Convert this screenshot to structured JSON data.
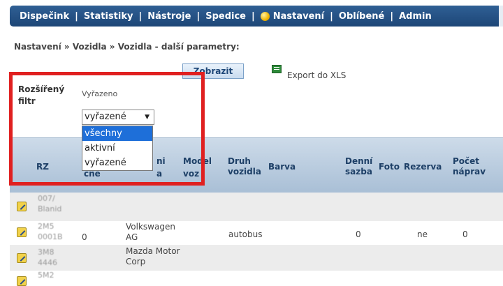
{
  "nav": {
    "items": [
      "Dispečink",
      "Statistiky",
      "Nástroje",
      "Spedice",
      "Nastavení",
      "Oblíbené",
      "Admin"
    ],
    "separator": "|"
  },
  "breadcrumb": "Nastavení » Vozidla » Vozidla - další parametry:",
  "toolbar": {
    "show_label": "Zobrazit",
    "export_label": "Export do XLS"
  },
  "filter": {
    "title": "Rozšířený filtr",
    "field_label": "Vyřazeno",
    "selected_value": "vyřazené",
    "options": [
      "všechny",
      "aktivní",
      "vyřazené"
    ],
    "highlighted_option": "všechny"
  },
  "table": {
    "headers": {
      "rz": "RZ",
      "vyrobce": "ni",
      "vyrobce_partial": "a",
      "model": "Model",
      "model_partial": "voz",
      "druh": "Druh vozidla",
      "barva": "Barva",
      "denni_sazba": "Denní sazba",
      "foto": "Foto",
      "rezerva": "Rezerva",
      "pocet_naprav": "Počet náprav",
      "stk_partial": "cne"
    },
    "rows": [
      {
        "rz": "007/",
        "rz2": "Blanid",
        "col2": "",
        "vyrobce": "",
        "druh": "",
        "sazba": "",
        "rezerva": "",
        "naprav": ""
      },
      {
        "rz": "2M5",
        "rz2": "0001B",
        "col2": "0",
        "vyrobce": "Volkswagen AG",
        "druh": "autobus",
        "sazba": "0",
        "rezerva": "ne",
        "naprav": "0"
      },
      {
        "rz": "3M8",
        "rz2": "4446",
        "col2": "",
        "vyrobce": "Mazda Motor Corp",
        "druh": "",
        "sazba": "",
        "rezerva": "",
        "naprav": ""
      },
      {
        "rz": "5M2",
        "rz2": "",
        "col2": "",
        "vyrobce": "",
        "druh": "",
        "sazba": "",
        "rezerva": "",
        "naprav": ""
      }
    ]
  },
  "colors": {
    "nav_bg": "#1d4677",
    "highlight": "#e02020",
    "selected_option": "#1e6fd9"
  }
}
